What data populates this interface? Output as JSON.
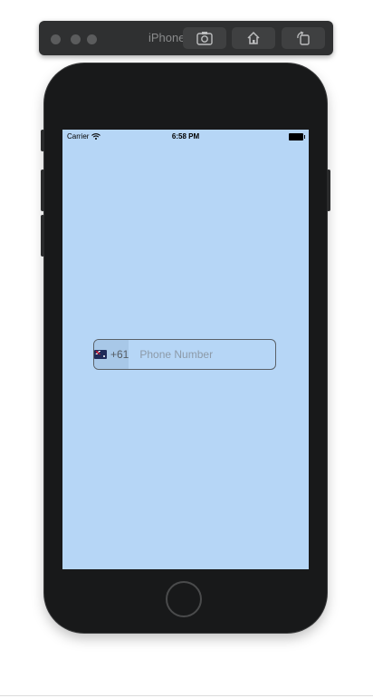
{
  "simulator": {
    "title": "iPhone SE...",
    "buttons": [
      {
        "icon": "screenshot-icon"
      },
      {
        "icon": "home-icon"
      },
      {
        "icon": "rotate-icon"
      }
    ]
  },
  "status_bar": {
    "carrier": "Carrier",
    "time": "6:58 PM"
  },
  "phone_input": {
    "country_flag": "australia-flag-icon",
    "country_code": "+61",
    "placeholder": "Phone Number",
    "value": ""
  },
  "colors": {
    "screen_bg": "#b6d6f6",
    "phone_body": "#18191a",
    "toolbar_bg": "#2f3031"
  }
}
